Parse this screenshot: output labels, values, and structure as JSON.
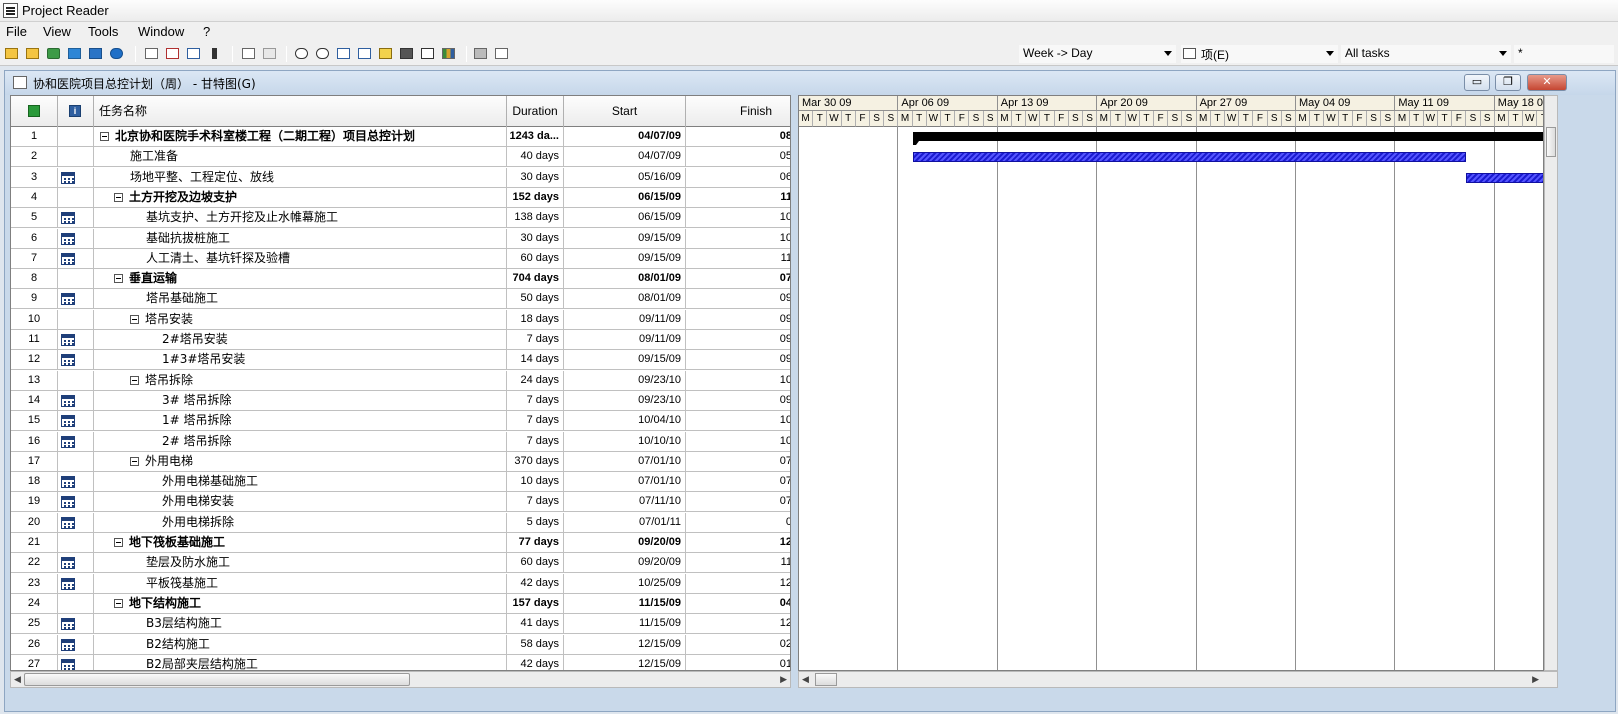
{
  "app": {
    "title": "Project Reader"
  },
  "menu": [
    "File",
    "View",
    "Tools",
    "Window",
    "?"
  ],
  "toolbar": {
    "icons": [
      "open-folder-icon",
      "open-file-icon",
      "google-drive-icon",
      "dropbox-icon",
      "box-icon",
      "onedrive-icon",
      "gantt-view-icon",
      "resource-sheet-icon",
      "task-usage-icon",
      "resource-icon",
      "table-icon",
      "lightning-icon",
      "zoom-out-icon",
      "zoom-in-icon",
      "copy-icon",
      "paste-icon",
      "highlight-icon",
      "binoculars-icon",
      "filter-icon",
      "chart-icon",
      "print-icon",
      "print-preview-icon"
    ],
    "timescale": "Week -> Day",
    "outline": "项(E)",
    "filter": "All tasks",
    "extra": "*"
  },
  "document": {
    "title": "协和医院项目总控计划（周） - 甘特图(G)",
    "buttons": {
      "minimize": "▭",
      "restore": "❐",
      "close": "✕"
    }
  },
  "grid": {
    "columns": {
      "id": "",
      "indicator": "",
      "name": "任务名称",
      "duration": "Duration",
      "start": "Start",
      "finish": "Finish"
    },
    "rows": [
      {
        "id": "1",
        "name": "北京协和医院手术科室楼工程（二期工程）项目总控计划",
        "duration": "1243 da...",
        "start": "04/07/09",
        "finish": "08",
        "level": 0,
        "summary": true,
        "cal": false
      },
      {
        "id": "2",
        "name": "施工准备",
        "duration": "40 days",
        "start": "04/07/09",
        "finish": "05",
        "level": 1,
        "summary": false,
        "cal": false
      },
      {
        "id": "3",
        "name": "场地平整、工程定位、放线",
        "duration": "30 days",
        "start": "05/16/09",
        "finish": "06",
        "level": 1,
        "summary": false,
        "cal": true
      },
      {
        "id": "4",
        "name": "土方开挖及边坡支护",
        "duration": "152 days",
        "start": "06/15/09",
        "finish": "11",
        "level": 1,
        "summary": true,
        "cal": false
      },
      {
        "id": "5",
        "name": "基坑支护、土方开挖及止水帷幕施工",
        "duration": "138 days",
        "start": "06/15/09",
        "finish": "10",
        "level": 2,
        "summary": false,
        "cal": true
      },
      {
        "id": "6",
        "name": "基础抗拔桩施工",
        "duration": "30 days",
        "start": "09/15/09",
        "finish": "10",
        "level": 2,
        "summary": false,
        "cal": true
      },
      {
        "id": "7",
        "name": "人工清土、基坑钎探及验槽",
        "duration": "60 days",
        "start": "09/15/09",
        "finish": "11",
        "level": 2,
        "summary": false,
        "cal": true
      },
      {
        "id": "8",
        "name": "垂直运输",
        "duration": "704 days",
        "start": "08/01/09",
        "finish": "07",
        "level": 1,
        "summary": true,
        "cal": false
      },
      {
        "id": "9",
        "name": "塔吊基础施工",
        "duration": "50 days",
        "start": "08/01/09",
        "finish": "09",
        "level": 2,
        "summary": false,
        "cal": true
      },
      {
        "id": "10",
        "name": "塔吊安装",
        "duration": "18 days",
        "start": "09/11/09",
        "finish": "09",
        "level": 2,
        "summary": false,
        "cal": false,
        "group": true
      },
      {
        "id": "11",
        "name": "2#塔吊安装",
        "duration": "7 days",
        "start": "09/11/09",
        "finish": "09",
        "level": 3,
        "summary": false,
        "cal": true
      },
      {
        "id": "12",
        "name": "1#3#塔吊安装",
        "duration": "14 days",
        "start": "09/15/09",
        "finish": "09",
        "level": 3,
        "summary": false,
        "cal": true
      },
      {
        "id": "13",
        "name": "塔吊拆除",
        "duration": "24 days",
        "start": "09/23/10",
        "finish": "10",
        "level": 2,
        "summary": false,
        "cal": false,
        "group": true
      },
      {
        "id": "14",
        "name": "3# 塔吊拆除",
        "duration": "7 days",
        "start": "09/23/10",
        "finish": "09",
        "level": 3,
        "summary": false,
        "cal": true
      },
      {
        "id": "15",
        "name": "1# 塔吊拆除",
        "duration": "7 days",
        "start": "10/04/10",
        "finish": "10",
        "level": 3,
        "summary": false,
        "cal": true
      },
      {
        "id": "16",
        "name": "2# 塔吊拆除",
        "duration": "7 days",
        "start": "10/10/10",
        "finish": "10",
        "level": 3,
        "summary": false,
        "cal": true
      },
      {
        "id": "17",
        "name": "外用电梯",
        "duration": "370 days",
        "start": "07/01/10",
        "finish": "07",
        "level": 2,
        "summary": false,
        "cal": false,
        "group": true
      },
      {
        "id": "18",
        "name": "外用电梯基础施工",
        "duration": "10 days",
        "start": "07/01/10",
        "finish": "07",
        "level": 3,
        "summary": false,
        "cal": true
      },
      {
        "id": "19",
        "name": "外用电梯安装",
        "duration": "7 days",
        "start": "07/11/10",
        "finish": "07",
        "level": 3,
        "summary": false,
        "cal": true
      },
      {
        "id": "20",
        "name": "外用电梯拆除",
        "duration": "5 days",
        "start": "07/01/11",
        "finish": "0",
        "level": 3,
        "summary": false,
        "cal": true
      },
      {
        "id": "21",
        "name": "地下筏板基础施工",
        "duration": "77 days",
        "start": "09/20/09",
        "finish": "12",
        "level": 1,
        "summary": true,
        "cal": false
      },
      {
        "id": "22",
        "name": "垫层及防水施工",
        "duration": "60 days",
        "start": "09/20/09",
        "finish": "11",
        "level": 2,
        "summary": false,
        "cal": true
      },
      {
        "id": "23",
        "name": "平板筏基施工",
        "duration": "42 days",
        "start": "10/25/09",
        "finish": "12",
        "level": 2,
        "summary": false,
        "cal": true
      },
      {
        "id": "24",
        "name": "地下结构施工",
        "duration": "157 days",
        "start": "11/15/09",
        "finish": "04",
        "level": 1,
        "summary": true,
        "cal": false
      },
      {
        "id": "25",
        "name": "B3层结构施工",
        "duration": "41 days",
        "start": "11/15/09",
        "finish": "12",
        "level": 2,
        "summary": false,
        "cal": true
      },
      {
        "id": "26",
        "name": "B2结构施工",
        "duration": "58 days",
        "start": "12/15/09",
        "finish": "02",
        "level": 2,
        "summary": false,
        "cal": true
      },
      {
        "id": "27",
        "name": "B2局部夹层结构施工",
        "duration": "42 days",
        "start": "12/15/09",
        "finish": "01",
        "level": 2,
        "summary": false,
        "cal": true
      }
    ]
  },
  "gantt": {
    "weeks": [
      "Mar 30 09",
      "Apr 06 09",
      "Apr 13 09",
      "Apr 20 09",
      "Apr 27 09",
      "May 04 09",
      "May 11 09",
      "May 18 0"
    ],
    "days": [
      "M",
      "T",
      "W",
      "T",
      "F",
      "S",
      "S"
    ],
    "timeline_start": "2009-03-30",
    "bars": [
      {
        "row": "1",
        "type": "summary",
        "start": "2009-04-07",
        "end": "open"
      },
      {
        "row": "2",
        "type": "task",
        "start": "2009-04-07",
        "end": "2009-05-16"
      },
      {
        "row": "3",
        "type": "task",
        "start": "2009-05-16",
        "end": "open"
      }
    ]
  }
}
